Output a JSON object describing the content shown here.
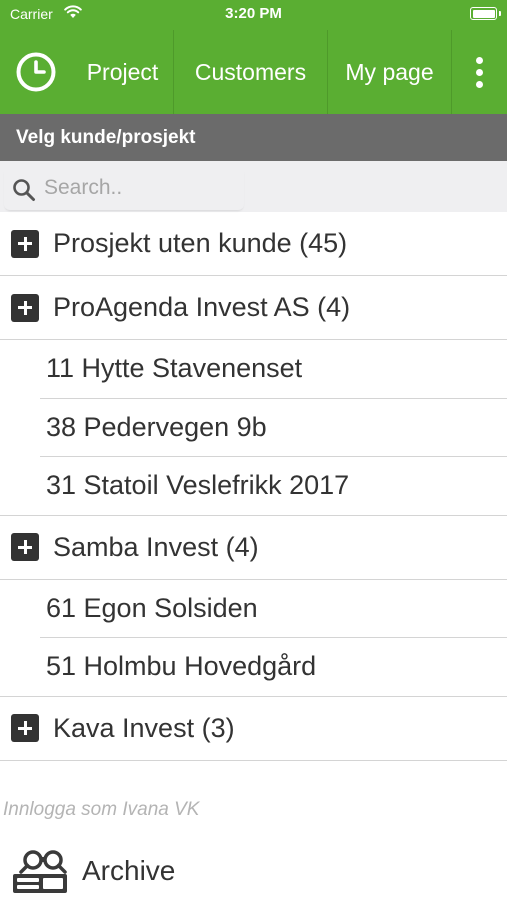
{
  "status_bar": {
    "carrier": "Carrier",
    "time": "3:20 PM"
  },
  "nav": {
    "logo_icon": "clock-icon",
    "items": [
      {
        "label": "Project"
      },
      {
        "label": "Customers"
      },
      {
        "label": "My page"
      }
    ],
    "more_icon": "more-vertical-icon"
  },
  "section_header": "Velg kunde/prosjekt",
  "search": {
    "placeholder": "Search.."
  },
  "list": {
    "groups": [
      {
        "label": "Prosjekt uten kunde (45)",
        "projects": []
      },
      {
        "label": "ProAgenda Invest AS (4)",
        "projects": [
          "11 Hytte Stavenenset",
          "38 Pedervegen 9b",
          "31 Statoil Veslefrikk 2017"
        ]
      },
      {
        "label": "Samba Invest (4)",
        "projects": [
          "61 Egon Solsiden",
          "51 Holmbu Hovedgård"
        ]
      },
      {
        "label": "Kava Invest (3)",
        "projects": []
      }
    ]
  },
  "login_info": "Innlogga som Ivana VK",
  "archive": {
    "label": "Archive",
    "icon": "archive-icon"
  },
  "colors": {
    "brand_green": "#5aae32",
    "header_gray": "#6b6b6b"
  }
}
